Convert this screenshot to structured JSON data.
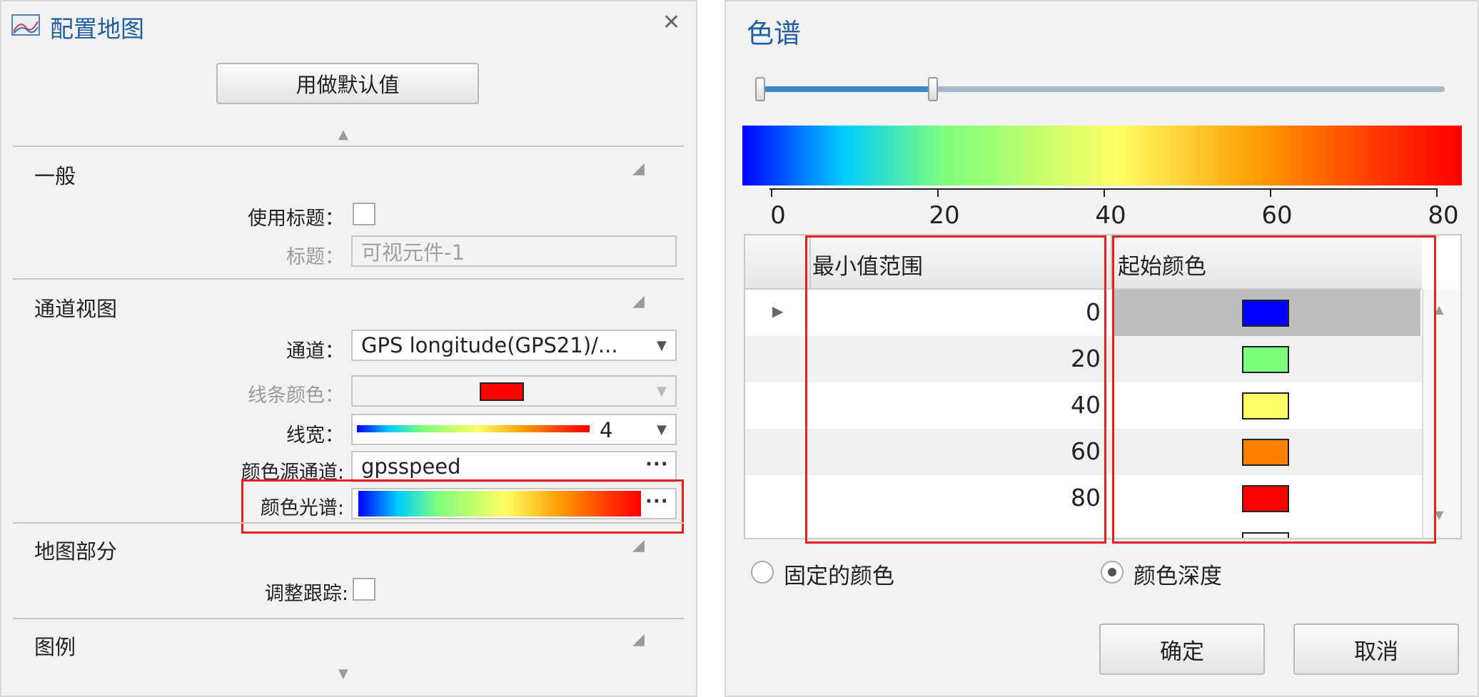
{
  "left": {
    "title": "配置地图",
    "close_glyph": "✕",
    "default_button": "用做默认值",
    "collapse_glyph": "▲",
    "expand_glyph": "▼",
    "section_glyph": "◢",
    "sections": {
      "general": {
        "title": "一般",
        "use_title_label": "使用标题：",
        "title_label": "标题：",
        "title_value": "可视元件-1"
      },
      "channel_view": {
        "title": "通道视图",
        "channel_label": "通道：",
        "channel_value": "GPS longitude(GPS21)/...",
        "line_color_label": "线条颜色：",
        "line_color": "#ff0000",
        "line_width_label": "线宽：",
        "line_width_value": "4",
        "color_source_label": "颜色源通道:",
        "color_source_value": "gpsspeed",
        "color_spectrum_label": "颜色光谱:",
        "ellipsis": "···"
      },
      "map_part": {
        "title": "地图部分",
        "adjust_tracking_label": "调整跟踪:"
      },
      "legend": {
        "title": "图例"
      }
    }
  },
  "right": {
    "title": "色谱",
    "slider_value_fraction": 0.25,
    "axis_ticks": [
      "0",
      "20",
      "40",
      "60",
      "80"
    ],
    "table": {
      "col_min": "最小值范围",
      "col_color": "起始颜色",
      "row_marker": "▶",
      "rows": [
        {
          "value": "0",
          "color": "#0000ff"
        },
        {
          "value": "20",
          "color": "#7dff7d"
        },
        {
          "value": "40",
          "color": "#ffff66"
        },
        {
          "value": "60",
          "color": "#ff8000"
        },
        {
          "value": "80",
          "color": "#ff0000"
        }
      ]
    },
    "radio_fixed": "固定的颜色",
    "radio_depth": "颜色深度",
    "selected_radio": "颜色深度",
    "ok_button": "确定",
    "cancel_button": "取消"
  }
}
